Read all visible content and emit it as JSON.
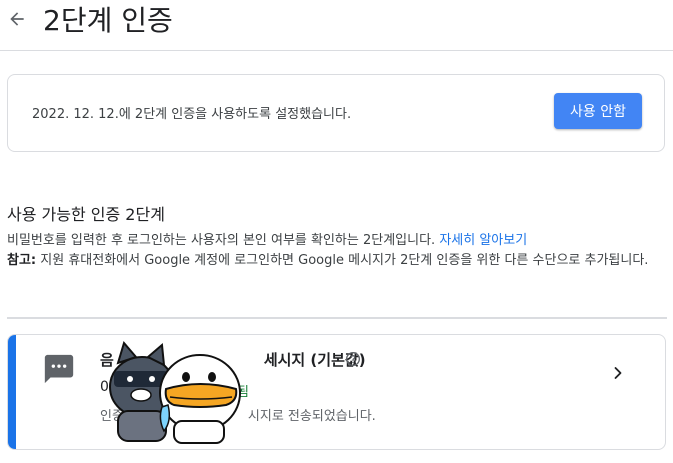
{
  "header": {
    "title": "2단계 인증"
  },
  "status": {
    "text": "2022. 12. 12.에 2단계 인증을 사용하도록 설정했습니다.",
    "disable_label": "사용 안함"
  },
  "section": {
    "heading": "사용 가능한 인증 2단계",
    "description": "비밀번호를 입력한 후 로그인하는 사용자의 본인 여부를 확인하는 2단계입니다.",
    "learn_more": "자세히 알아보기",
    "note_label": "참고:",
    "note_text": "지원 휴대전화에서 Google 계정에 로그인하면 Google 메시지가 2단계 인증을 위한 다른 수단으로 추가됩니다."
  },
  "method": {
    "title_start": "음",
    "title_end": "세시지 (기본값)",
    "phone_start": "0",
    "verified": "증됨",
    "desc_start": "인증",
    "desc_end": "시지로 전송되었습니다.",
    "accent_color": "#1a73e8",
    "icons": [
      "message-icon",
      "help-circle-icon",
      "chevron-right-icon"
    ]
  },
  "colors": {
    "primary": "#4285f4",
    "link": "#1a73e8",
    "verified": "#188038",
    "border": "#dadce0"
  }
}
